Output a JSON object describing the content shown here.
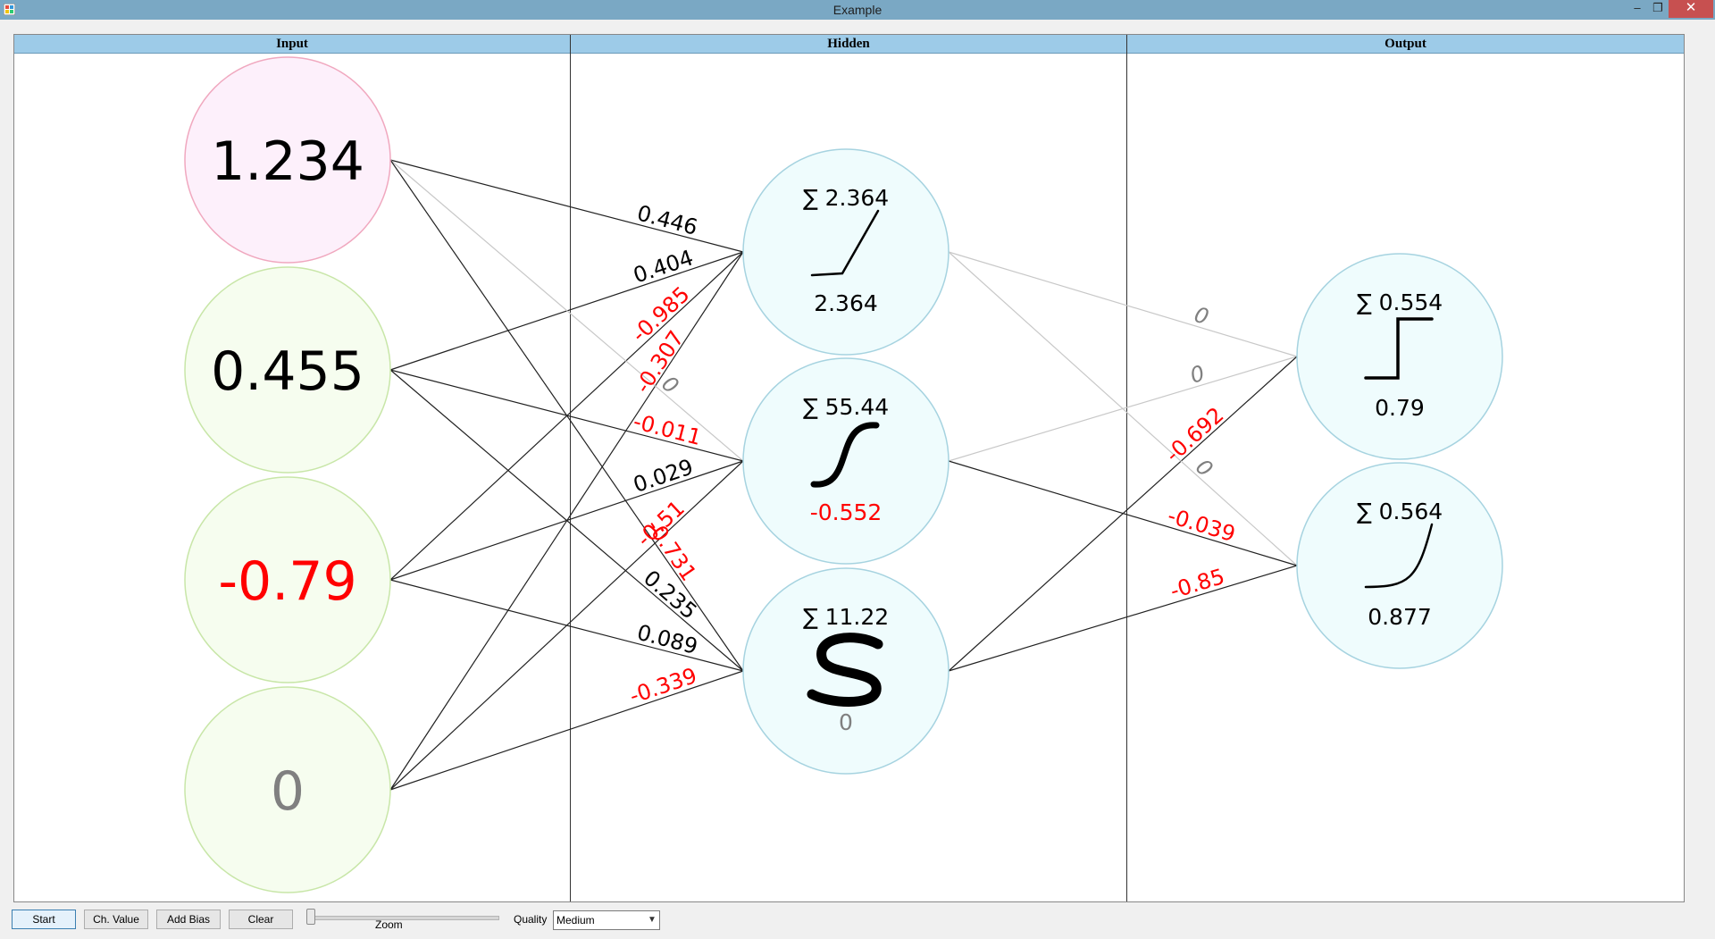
{
  "window": {
    "title": "Example",
    "min": "–",
    "max": "❐",
    "close": "✕"
  },
  "columns": [
    "Input",
    "Hidden",
    "Output"
  ],
  "colors": {
    "input_first_fill": "#fdf0fb",
    "input_first_stroke": "#f0a8bf",
    "input_fill": "#f6fdef",
    "input_stroke": "#c8e6a8",
    "node_fill": "#effcfd",
    "node_stroke": "#a6d3e0",
    "negative": "#ff0000",
    "zero": "#808080",
    "positive": "#000000"
  },
  "input_nodes": [
    {
      "value": "1.234",
      "sign": "positive"
    },
    {
      "value": "0.455",
      "sign": "positive"
    },
    {
      "value": "-0.79",
      "sign": "negative"
    },
    {
      "value": "0",
      "sign": "zero"
    }
  ],
  "hidden_nodes": [
    {
      "sum": "∑ 2.364",
      "activation": "relu-icon",
      "output": "2.364",
      "sign": "positive"
    },
    {
      "sum": "∑ 55.44",
      "activation": "tanh-icon",
      "output": "-0.552",
      "sign": "negative"
    },
    {
      "sum": "∑ 11.22",
      "activation": "sigmoid-icon",
      "output": "0",
      "sign": "zero"
    }
  ],
  "output_nodes": [
    {
      "sum": "∑ 0.554",
      "activation": "step-icon",
      "output": "0.79",
      "sign": "positive"
    },
    {
      "sum": "∑ 0.564",
      "activation": "exponential-icon",
      "output": "0.877",
      "sign": "positive"
    }
  ],
  "input_hidden_weights": [
    {
      "from": 0,
      "to": 0,
      "label": "0.446",
      "sign": "positive"
    },
    {
      "from": 1,
      "to": 0,
      "label": "0.404",
      "sign": "positive"
    },
    {
      "from": 2,
      "to": 0,
      "label": "-0.985",
      "sign": "negative"
    },
    {
      "from": 3,
      "to": 0,
      "label": "-0.307",
      "sign": "negative"
    },
    {
      "from": 0,
      "to": 1,
      "label": "0",
      "sign": "zero"
    },
    {
      "from": 1,
      "to": 1,
      "label": "-0.011",
      "sign": "negative"
    },
    {
      "from": 2,
      "to": 1,
      "label": "0.029",
      "sign": "positive"
    },
    {
      "from": 3,
      "to": 1,
      "label": "-0.51",
      "sign": "negative"
    },
    {
      "from": 0,
      "to": 2,
      "label": "-0.731",
      "sign": "negative"
    },
    {
      "from": 1,
      "to": 2,
      "label": "0.235",
      "sign": "positive"
    },
    {
      "from": 2,
      "to": 2,
      "label": "0.089",
      "sign": "positive"
    },
    {
      "from": 3,
      "to": 2,
      "label": "-0.339",
      "sign": "negative"
    }
  ],
  "hidden_output_weights": [
    {
      "from": 0,
      "to": 0,
      "label": "0",
      "sign": "zero"
    },
    {
      "from": 1,
      "to": 0,
      "label": "0",
      "sign": "zero"
    },
    {
      "from": 2,
      "to": 0,
      "label": "-0.692",
      "sign": "negative"
    },
    {
      "from": 0,
      "to": 1,
      "label": "0",
      "sign": "zero"
    },
    {
      "from": 1,
      "to": 1,
      "label": "-0.039",
      "sign": "negative"
    },
    {
      "from": 2,
      "to": 1,
      "label": "-0.85",
      "sign": "negative"
    }
  ],
  "toolbar": {
    "start": "Start",
    "change_value": "Ch. Value",
    "add_bias": "Add Bias",
    "clear": "Clear",
    "zoom_label": "Zoom",
    "zoom_level": 0,
    "quality_label": "Quality",
    "quality_value": "Medium"
  }
}
